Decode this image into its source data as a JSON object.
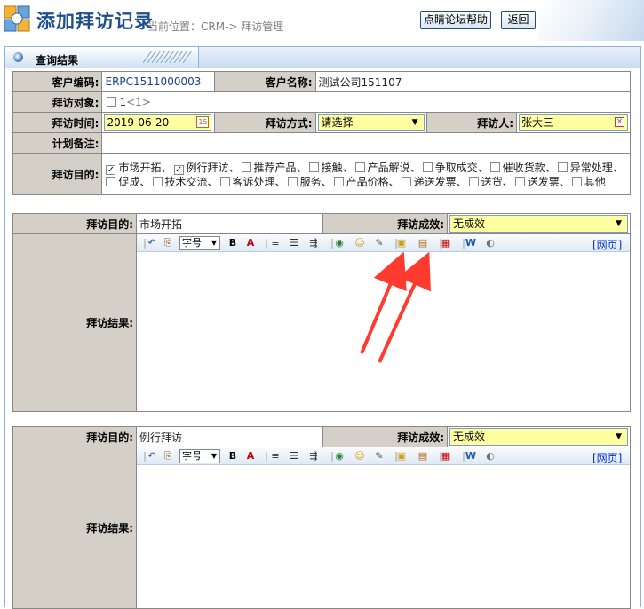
{
  "header": {
    "title": "添加拜访记录",
    "location": "当前位置：CRM-> 拜访管理",
    "help_button": "点睛论坛帮助",
    "back_button": "返回"
  },
  "panel": {
    "tab_title": "查询结果"
  },
  "form": {
    "customer_code_label": "客户编码:",
    "customer_code": "ERPC1511000003",
    "customer_name_label": "客户名称:",
    "customer_name": "测试公司151107",
    "visit_target_label": "拜访对象:",
    "visit_target_option": "1",
    "visit_target_option_note": "<1>",
    "visit_time_label": "拜访时间:",
    "visit_time": "2019-06-20",
    "visit_method_label": "拜访方式:",
    "visit_method": "请选择",
    "visitor_label": "拜访人:",
    "visitor": "张大三",
    "plan_note_label": "计划备注:",
    "purpose_label": "拜访目的:"
  },
  "purposes": [
    {
      "label": "市场开拓",
      "checked": true
    },
    {
      "label": "例行拜访",
      "checked": true
    },
    {
      "label": "推荐产品",
      "checked": false
    },
    {
      "label": "接触",
      "checked": false
    },
    {
      "label": "产品解说",
      "checked": false
    },
    {
      "label": "争取成交",
      "checked": false
    },
    {
      "label": "催收货款",
      "checked": false
    },
    {
      "label": "异常处理",
      "checked": false
    },
    {
      "label": "促成",
      "checked": false
    },
    {
      "label": "技术交流",
      "checked": false
    },
    {
      "label": "客诉处理",
      "checked": false
    },
    {
      "label": "服务",
      "checked": false
    },
    {
      "label": "产品价格",
      "checked": false
    },
    {
      "label": "递送发票",
      "checked": false
    },
    {
      "label": "送货",
      "checked": false
    },
    {
      "label": "送发票",
      "checked": false
    },
    {
      "label": "其他",
      "checked": false
    }
  ],
  "sections": [
    {
      "purpose_label": "拜访目的:",
      "purpose_value": "市场开拓",
      "result_effect_label": "拜访成效:",
      "result_effect": "无成效",
      "result_label": "拜访结果:"
    },
    {
      "purpose_label": "拜访目的:",
      "purpose_value": "例行拜访",
      "result_effect_label": "拜访成效:",
      "result_effect": "无成效",
      "result_label": "拜访结果:"
    }
  ],
  "editor": {
    "font_size_label": "字号",
    "web_link": "[网页]"
  },
  "colors": {
    "title": "#1d4f8c",
    "label_bg": "#d4d0c8",
    "highlight_input": "#ffffa0",
    "annotation_arrow": "#ff3b30"
  }
}
